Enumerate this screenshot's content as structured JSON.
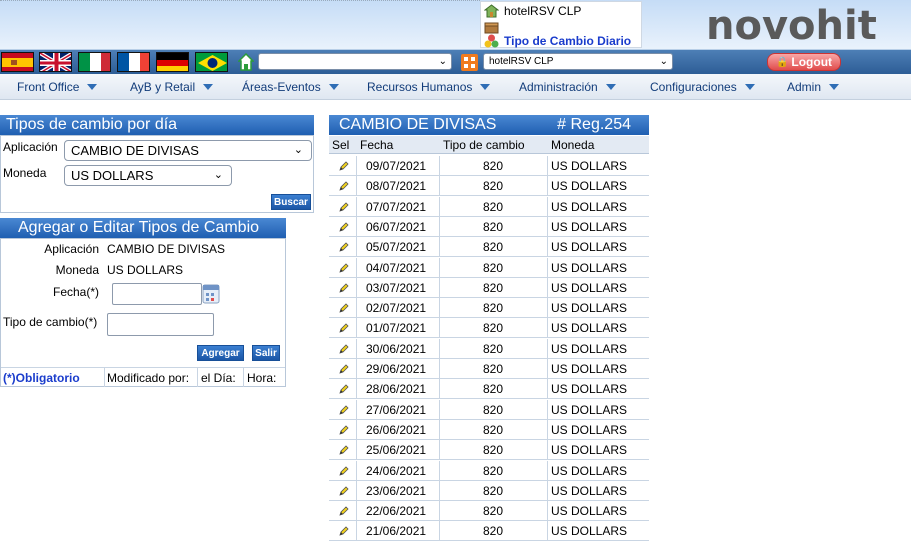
{
  "header": {
    "logo": "novohit",
    "modules": [
      {
        "label": "hotelRSV CLP",
        "icon": "hotel-icon"
      },
      {
        "label": "",
        "icon": "box-icon"
      },
      {
        "label": "Tipo de Cambio Diario",
        "icon": "currency-icon"
      }
    ]
  },
  "flagbar": {
    "flags": [
      "spain-flag-icon",
      "uk-flag-icon",
      "italy-flag-icon",
      "france-flag-icon",
      "germany-flag-icon",
      "brazil-flag-icon"
    ],
    "search_select": "",
    "hotel_select": "hotelRSV CLP",
    "logout_label": "Logout"
  },
  "nav": {
    "items": [
      "Front Office",
      "AyB y Retail",
      "Áreas-Eventos",
      "Recursos Humanos",
      "Administración",
      "Configuraciones",
      "Admin"
    ]
  },
  "filter_panel": {
    "title": "Tipos de cambio por día",
    "aplicacion_label": "Aplicación",
    "aplicacion_value": "CAMBIO DE DIVISAS",
    "moneda_label": "Moneda",
    "moneda_value": "US DOLLARS",
    "buscar_label": "Buscar"
  },
  "edit_panel": {
    "title": "Agregar o Editar Tipos de Cambio",
    "aplicacion_label": "Aplicación",
    "aplicacion_value": "CAMBIO DE DIVISAS",
    "moneda_label": "Moneda",
    "moneda_value": "US DOLLARS",
    "fecha_label": "Fecha(*)",
    "fecha_value": "",
    "tipo_label": "Tipo de cambio(*)",
    "tipo_value": "",
    "agregar_label": "Agregar",
    "salir_label": "Salir",
    "obligatorio": "(*)Obligatorio",
    "modificado": "Modificado por:",
    "el_dia": "el Día:",
    "hora": "Hora:"
  },
  "table": {
    "title": "CAMBIO DE DIVISAS",
    "reg_count": "# Reg.254",
    "headers": [
      "Sel",
      "Fecha",
      "Tipo de cambio",
      "Moneda"
    ],
    "rows": [
      {
        "fecha": "09/07/2021",
        "tipo": "820",
        "moneda": "US DOLLARS"
      },
      {
        "fecha": "08/07/2021",
        "tipo": "820",
        "moneda": "US DOLLARS"
      },
      {
        "fecha": "07/07/2021",
        "tipo": "820",
        "moneda": "US DOLLARS"
      },
      {
        "fecha": "06/07/2021",
        "tipo": "820",
        "moneda": "US DOLLARS"
      },
      {
        "fecha": "05/07/2021",
        "tipo": "820",
        "moneda": "US DOLLARS"
      },
      {
        "fecha": "04/07/2021",
        "tipo": "820",
        "moneda": "US DOLLARS"
      },
      {
        "fecha": "03/07/2021",
        "tipo": "820",
        "moneda": "US DOLLARS"
      },
      {
        "fecha": "02/07/2021",
        "tipo": "820",
        "moneda": "US DOLLARS"
      },
      {
        "fecha": "01/07/2021",
        "tipo": "820",
        "moneda": "US DOLLARS"
      },
      {
        "fecha": "30/06/2021",
        "tipo": "820",
        "moneda": "US DOLLARS"
      },
      {
        "fecha": "29/06/2021",
        "tipo": "820",
        "moneda": "US DOLLARS"
      },
      {
        "fecha": "28/06/2021",
        "tipo": "820",
        "moneda": "US DOLLARS"
      },
      {
        "fecha": "27/06/2021",
        "tipo": "820",
        "moneda": "US DOLLARS"
      },
      {
        "fecha": "26/06/2021",
        "tipo": "820",
        "moneda": "US DOLLARS"
      },
      {
        "fecha": "25/06/2021",
        "tipo": "820",
        "moneda": "US DOLLARS"
      },
      {
        "fecha": "24/06/2021",
        "tipo": "820",
        "moneda": "US DOLLARS"
      },
      {
        "fecha": "23/06/2021",
        "tipo": "820",
        "moneda": "US DOLLARS"
      },
      {
        "fecha": "22/06/2021",
        "tipo": "820",
        "moneda": "US DOLLARS"
      },
      {
        "fecha": "21/06/2021",
        "tipo": "820",
        "moneda": "US DOLLARS"
      }
    ]
  },
  "colors": {
    "accent": "#1f5fb1",
    "nav_text": "#123c7a",
    "obligatorio": "#1a3ccc",
    "logout": "#e04c4c"
  }
}
